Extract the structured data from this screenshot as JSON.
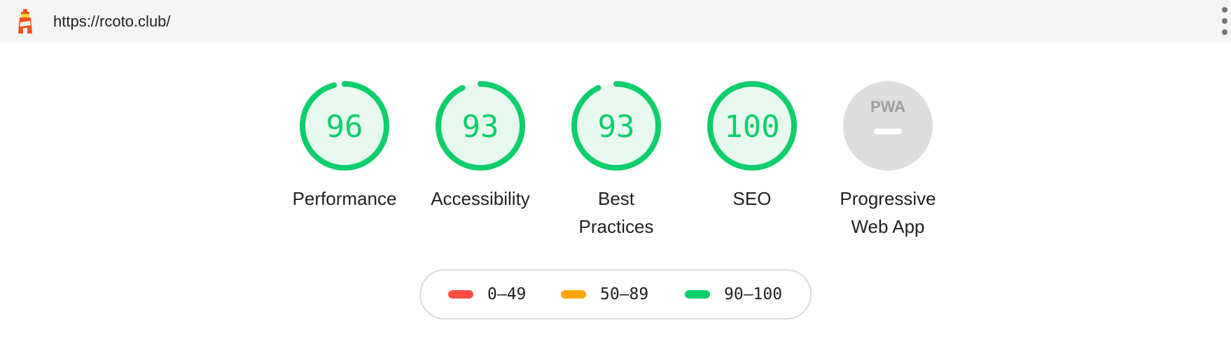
{
  "browser": {
    "url": "https://rcoto.club/",
    "logo_icon": "lighthouse-icon",
    "menu_icon": "more-vertical-icon"
  },
  "colors": {
    "pass": "#0cce6b",
    "pass_bg": "#e7f8ef",
    "average": "#ffa400",
    "fail": "#ff4e42",
    "na": "#dddddd",
    "na_text": "#9e9e9e"
  },
  "gauges": [
    {
      "label": "Performance",
      "score": "96",
      "fraction": 0.96
    },
    {
      "label": "Accessibility",
      "score": "93",
      "fraction": 0.93
    },
    {
      "label": "Best\nPractices",
      "score": "93",
      "fraction": 0.93
    },
    {
      "label": "SEO",
      "score": "100",
      "fraction": 1.0
    },
    {
      "label": "Progressive\nWeb App",
      "score": "PWA",
      "fraction": null,
      "status": "not-applicable"
    }
  ],
  "legend": [
    {
      "range": "0–49",
      "color": "#ff4e42"
    },
    {
      "range": "50–89",
      "color": "#ffa400"
    },
    {
      "range": "90–100",
      "color": "#0cce6b"
    }
  ]
}
